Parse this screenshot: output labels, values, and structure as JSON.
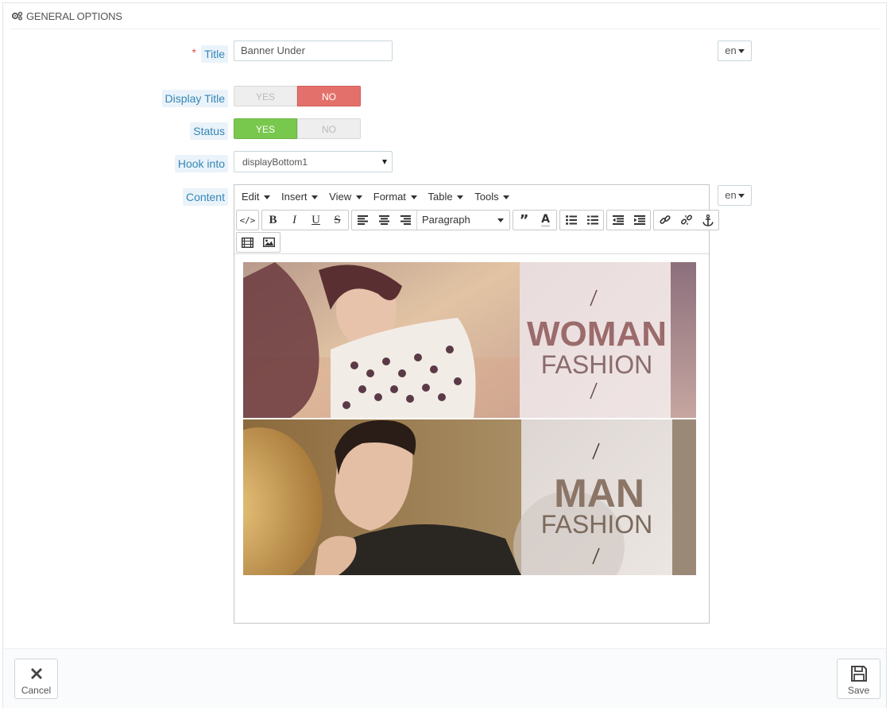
{
  "panel": {
    "heading": "GENERAL OPTIONS",
    "heading_icon": "cogs-icon"
  },
  "form": {
    "title": {
      "required_mark": "*",
      "label": "Title",
      "value": "Banner Under",
      "lang": "en"
    },
    "display_title": {
      "label": "Display Title",
      "yes": "YES",
      "no": "NO",
      "selected": "NO"
    },
    "status": {
      "label": "Status",
      "yes": "YES",
      "no": "NO",
      "selected": "YES"
    },
    "hook": {
      "label": "Hook into",
      "value": "displayBottom1"
    },
    "content": {
      "label": "Content",
      "lang": "en"
    }
  },
  "editor": {
    "menus": [
      "Edit",
      "Insert",
      "View",
      "Format",
      "Table",
      "Tools"
    ],
    "block_format": "Paragraph",
    "banners": [
      {
        "line1": "WOMAN",
        "line2": "FASHION"
      },
      {
        "line1": "MAN",
        "line2": "FASHION"
      }
    ]
  },
  "footer": {
    "cancel": "Cancel",
    "save": "Save"
  },
  "colors": {
    "label_bg": "#eaf3f9",
    "label_text": "#3586b7",
    "no_red": "#e4706b",
    "yes_green": "#79c84e"
  }
}
